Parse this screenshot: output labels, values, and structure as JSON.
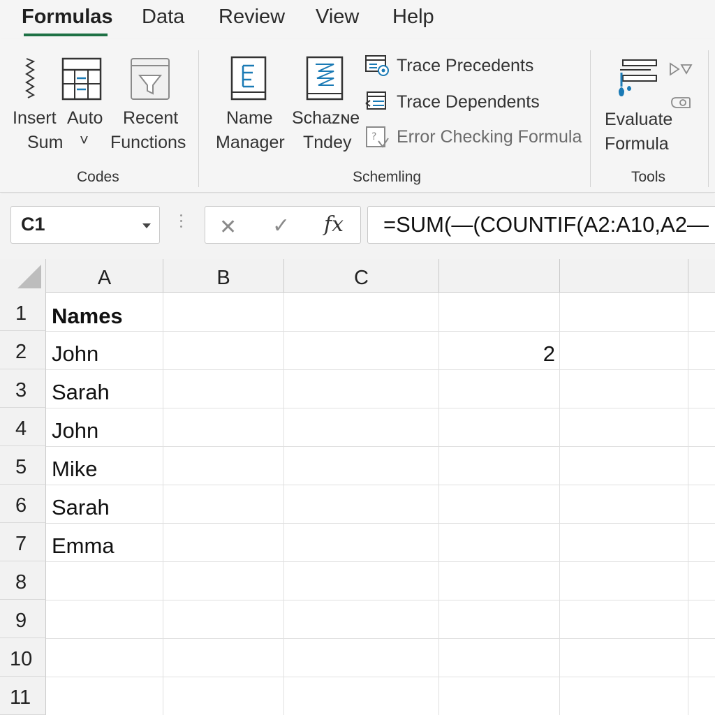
{
  "tabs": [
    "Formulas",
    "Data",
    "Review",
    "View",
    "Help"
  ],
  "ribbon": {
    "codes_group": {
      "label": "Codes",
      "insert_sum": [
        "Insert",
        "Sum"
      ],
      "auto": [
        "Auto",
        "˅"
      ],
      "recent": [
        "Recent",
        "Functions"
      ]
    },
    "scheming_group": {
      "label": "Schemling",
      "name_manager": [
        "Name",
        "Manager"
      ],
      "schaze": [
        "Schazɴe",
        "Tndey"
      ],
      "trace_precedents": "Trace Precedents",
      "trace_dependents": "Trace Dependents",
      "error_checking": "Error Checking Formula"
    },
    "tools_group": {
      "label": "Tools",
      "evaluate": [
        "Evaluate",
        "Formula"
      ]
    }
  },
  "formula_bar": {
    "name_box": "C1",
    "cancel": "✕",
    "enter": "✓",
    "fx": "fx",
    "formula": "=SUM(—(COUNTIF(A2:A10,A2—"
  },
  "sheet": {
    "columns": [
      "A",
      "B",
      "C",
      "",
      ""
    ],
    "rows": [
      "1",
      "2",
      "3",
      "4",
      "5",
      "6",
      "7",
      "8",
      "9",
      "10",
      "11"
    ],
    "col_a": [
      "Names",
      "John",
      "Sarah",
      "John",
      "Mike",
      "Sarah",
      "Emma"
    ],
    "d2_value": "2"
  },
  "colors": {
    "accent": "#1e7145",
    "icon_blue": "#1a7ab5",
    "ribbon_bg": "#f5f5f5",
    "header_bg": "#f2f2f2"
  },
  "icons": [
    "sigma-icon",
    "table-icon",
    "funnel-icon",
    "name-manager-icon",
    "schaze-icon",
    "trace-precedents-icon",
    "trace-dependents-icon",
    "error-check-icon",
    "evaluate-formula-icon",
    "watch-icon"
  ]
}
